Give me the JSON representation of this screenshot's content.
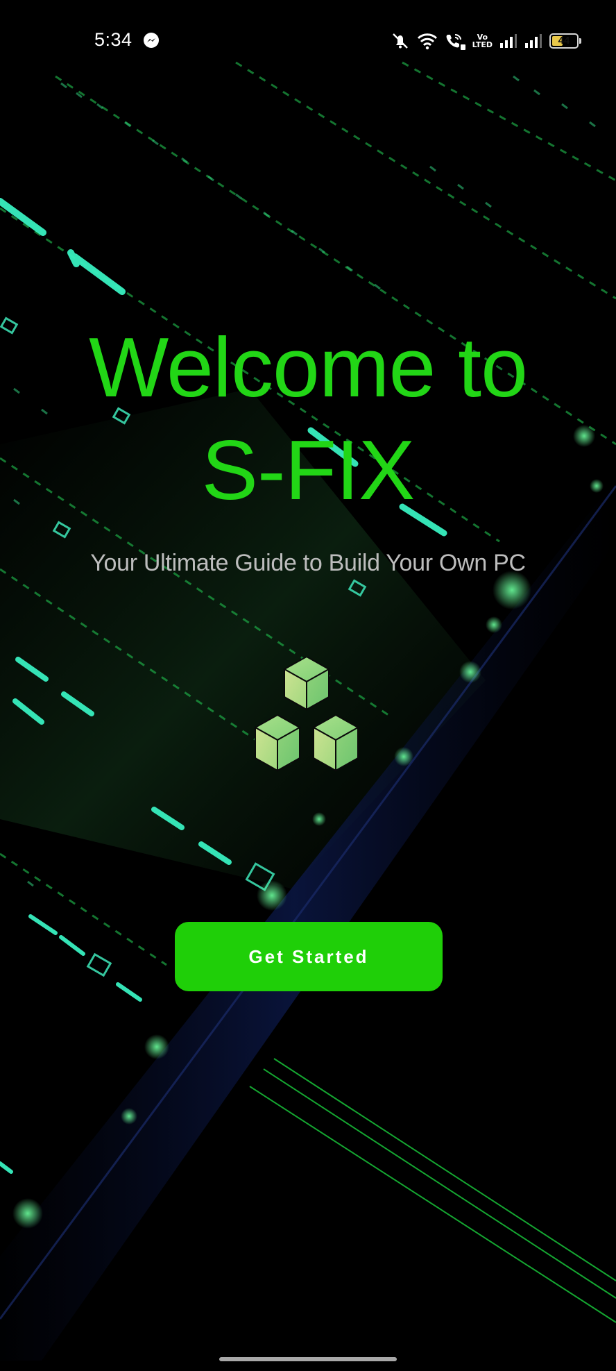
{
  "status_bar": {
    "time": "5:34",
    "volte_line1": "Vo",
    "volte_line2": "LTED",
    "battery_level": "44",
    "battery_fraction": 0.44,
    "icons": [
      "messenger-icon",
      "mute-icon",
      "wifi-icon",
      "wifi-calling-icon",
      "volte-icon",
      "signal-1-icon",
      "signal-2-icon",
      "battery-icon"
    ]
  },
  "welcome": {
    "title_line1": "Welcome to",
    "title_line2": "S-FIX",
    "subtitle": "Your Ultimate Guide to Build Your Own PC"
  },
  "logo": {
    "icon": "cubes-logo-icon",
    "color": "#9cd67a"
  },
  "actions": {
    "get_started_label": "Get Started"
  },
  "colors": {
    "accent": "#22d616",
    "button": "#1fcf08",
    "background": "#000000",
    "subtitle": "#bdbdbd",
    "neon_trace": "#38f0b0"
  }
}
